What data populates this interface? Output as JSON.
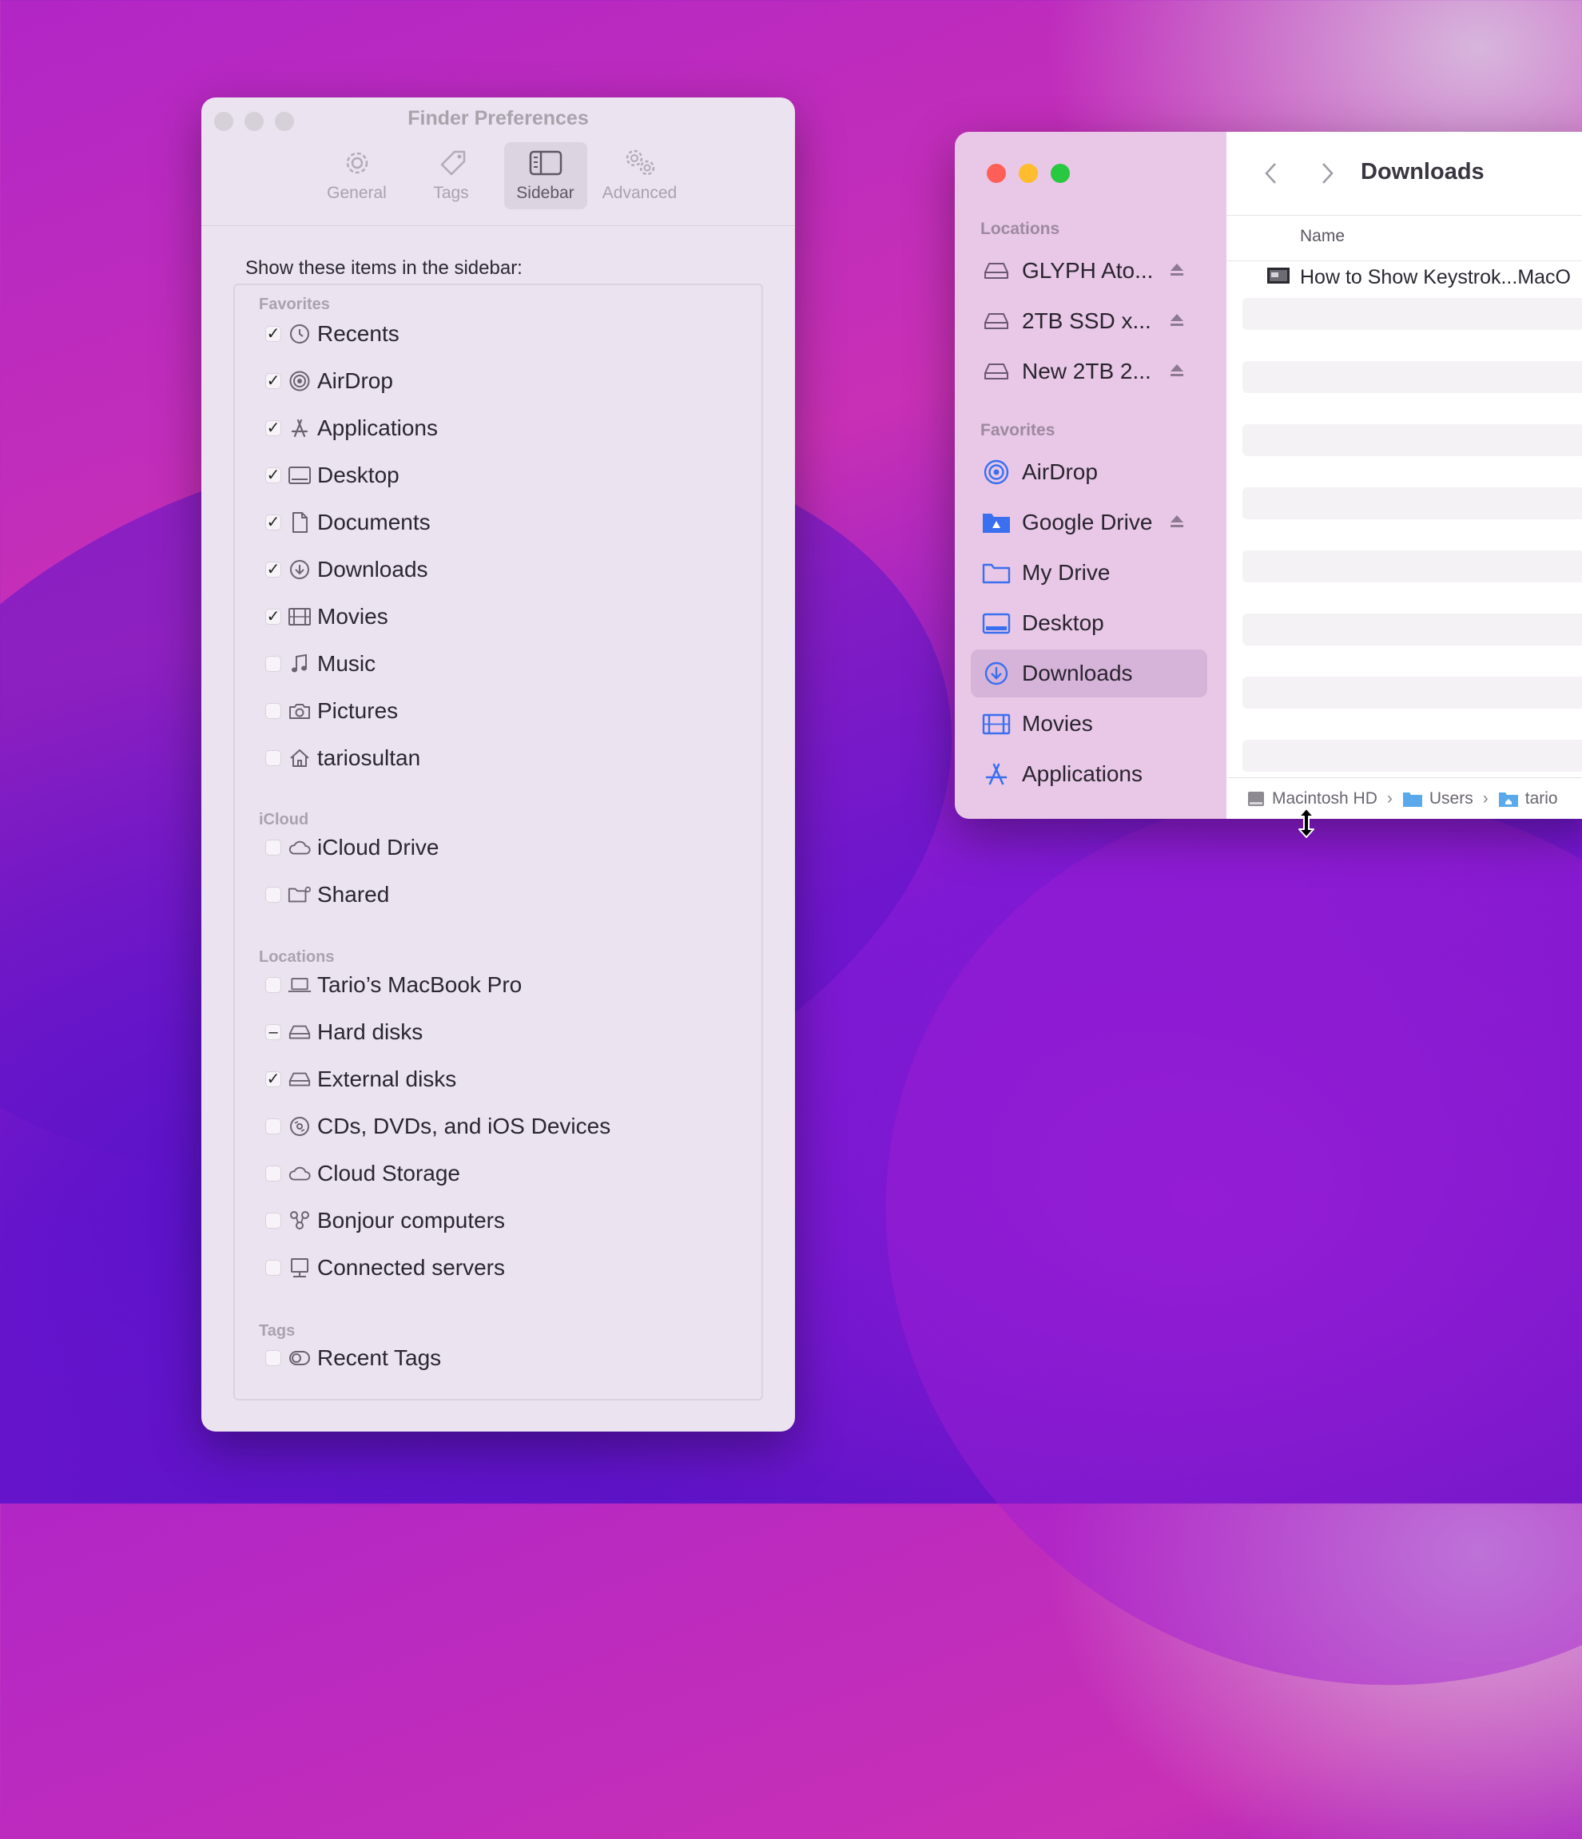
{
  "preferences": {
    "title": "Finder Preferences",
    "tabs": [
      {
        "label": "General",
        "icon": "gear-icon"
      },
      {
        "label": "Tags",
        "icon": "tag-icon"
      },
      {
        "label": "Sidebar",
        "icon": "sidebar-icon",
        "active": true
      },
      {
        "label": "Advanced",
        "icon": "gears-icon"
      }
    ],
    "intro": "Show these items in the sidebar:",
    "sections": {
      "favorites": "Favorites",
      "icloud": "iCloud",
      "locations": "Locations",
      "tags": "Tags"
    },
    "items": [
      {
        "label": "Recents",
        "state": "checked",
        "icon": "clock-icon"
      },
      {
        "label": "AirDrop",
        "state": "checked",
        "icon": "airdrop-icon"
      },
      {
        "label": "Applications",
        "state": "checked",
        "icon": "applications-icon"
      },
      {
        "label": "Desktop",
        "state": "checked",
        "icon": "desktop-icon"
      },
      {
        "label": "Documents",
        "state": "checked",
        "icon": "document-icon"
      },
      {
        "label": "Downloads",
        "state": "checked",
        "icon": "download-icon"
      },
      {
        "label": "Movies",
        "state": "checked",
        "icon": "film-icon"
      },
      {
        "label": "Music",
        "state": "unchecked",
        "icon": "music-note-icon"
      },
      {
        "label": "Pictures",
        "state": "unchecked",
        "icon": "camera-icon"
      },
      {
        "label": "tariosultan",
        "state": "unchecked",
        "icon": "home-icon"
      },
      {
        "label": "iCloud Drive",
        "state": "unchecked",
        "icon": "cloud-icon"
      },
      {
        "label": "Shared",
        "state": "unchecked",
        "icon": "shared-folder-icon"
      },
      {
        "label": "Tario’s MacBook Pro",
        "state": "unchecked",
        "icon": "laptop-icon"
      },
      {
        "label": "Hard disks",
        "state": "mixed",
        "icon": "hard-disk-icon"
      },
      {
        "label": "External disks",
        "state": "checked",
        "icon": "external-disk-icon"
      },
      {
        "label": "CDs, DVDs, and iOS Devices",
        "state": "unchecked",
        "icon": "disc-icon"
      },
      {
        "label": "Cloud Storage",
        "state": "unchecked",
        "icon": "cloud-icon"
      },
      {
        "label": "Bonjour computers",
        "state": "unchecked",
        "icon": "bonjour-icon"
      },
      {
        "label": "Connected servers",
        "state": "unchecked",
        "icon": "server-icon"
      },
      {
        "label": "Recent Tags",
        "state": "unchecked",
        "icon": "tags-icon"
      }
    ]
  },
  "finder": {
    "title": "Downloads",
    "sidebar": {
      "locations_label": "Locations",
      "favorites_label": "Favorites",
      "locations": [
        {
          "label": "GLYPH Ato...",
          "icon": "drive-icon",
          "eject": true
        },
        {
          "label": "2TB SSD x...",
          "icon": "drive-icon",
          "eject": true
        },
        {
          "label": "New 2TB 2...",
          "icon": "drive-icon",
          "eject": true
        }
      ],
      "favorites": [
        {
          "label": "AirDrop",
          "icon": "airdrop-icon"
        },
        {
          "label": "Google Drive",
          "icon": "google-drive-folder-icon",
          "eject": true
        },
        {
          "label": "My Drive",
          "icon": "folder-icon"
        },
        {
          "label": "Desktop",
          "icon": "desktop-icon"
        },
        {
          "label": "Downloads",
          "icon": "download-icon",
          "selected": true
        },
        {
          "label": "Movies",
          "icon": "film-icon"
        },
        {
          "label": "Applications",
          "icon": "applications-icon"
        }
      ]
    },
    "column_name": "Name",
    "file": "How to Show Keystrok...MacO",
    "path": [
      "Macintosh HD",
      "Users",
      "tario"
    ],
    "colors": {
      "close": "#ff5f57",
      "minimize": "#febc2e",
      "zoom": "#28c840",
      "accent": "#3a6ff0"
    }
  }
}
